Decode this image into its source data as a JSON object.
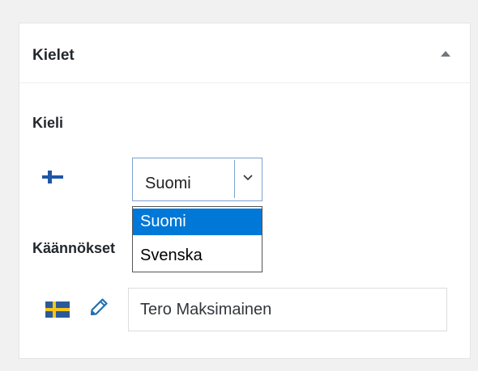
{
  "panel": {
    "title": "Kielet",
    "collapse_icon": "triangle-up-icon"
  },
  "language": {
    "label": "Kieli",
    "flag_icon": "finland-flag-icon",
    "selected_value": "Suomi",
    "options": [
      {
        "label": "Suomi",
        "selected": true
      },
      {
        "label": "Svenska",
        "selected": false
      }
    ]
  },
  "translations": {
    "label": "Käännökset",
    "items": [
      {
        "flag_icon": "sweden-flag-icon",
        "edit_icon": "pencil-icon",
        "value": "Tero Maksimainen"
      }
    ]
  },
  "colors": {
    "option_highlight": "#0078d7",
    "focus_border": "#7da2ce"
  }
}
